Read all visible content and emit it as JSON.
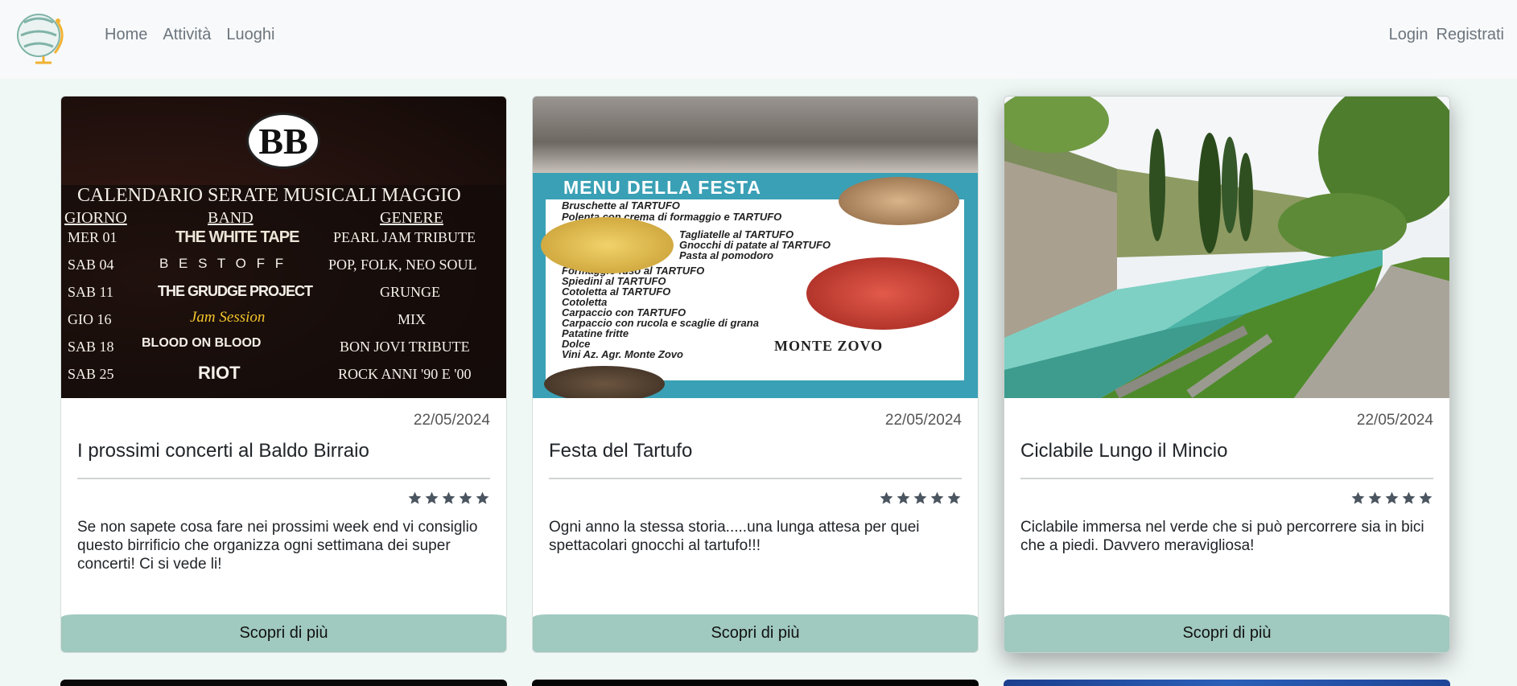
{
  "nav": {
    "left": [
      "Home",
      "Attività",
      "Luoghi"
    ],
    "right": [
      "Login",
      "Registrati"
    ]
  },
  "cards": [
    {
      "date": "22/05/2024",
      "title": "I prossimi concerti al Baldo Birraio",
      "rating": 5,
      "text": "Se non sapete cosa fare nei prossimi week end vi consiglio questo birrificio che organizza ogni settimana dei super concerti! Ci si vede li!",
      "button": "Scopri di più",
      "image": {
        "logo": "BB",
        "heading": "CALENDARIO SERATE MUSICALI MAGGIO",
        "columns": [
          "GIORNO",
          "BAND",
          "GENERE"
        ],
        "rows": [
          [
            "MER 01",
            "THE WHITE TAPE",
            "PEARL JAM TRIBUTE"
          ],
          [
            "SAB 04",
            "B E S T O F F",
            "POP, FOLK, NEO SOUL"
          ],
          [
            "SAB 11",
            "THE GRUDGE PROJECT",
            "GRUNGE"
          ],
          [
            "GIO 16",
            "Jam Session",
            "MIX"
          ],
          [
            "SAB 18",
            "BLOOD ON BLOOD",
            "BON JOVI TRIBUTE"
          ],
          [
            "SAB 25",
            "RIOT",
            "ROCK ANNI '90 E '00"
          ]
        ]
      }
    },
    {
      "date": "22/05/2024",
      "title": "Festa del Tartufo",
      "rating": 5,
      "text": "Ogni anno la stessa storia.....una lunga attesa per quei spettacolari gnocchi al tartufo!!!",
      "button": "Scopri di più",
      "image": {
        "heading": "MENU DELLA FESTA",
        "items": [
          "Bruschette al TARTUFO",
          "Polenta con crema di formaggio e TARTUFO",
          "Tagliatelle al TARTUFO",
          "Gnocchi di patate al TARTUFO",
          "Pasta al pomodoro",
          "Formaggio fuso al TARTUFO",
          "Spiedini al TARTUFO",
          "Cotoletta al TARTUFO",
          "Cotoletta",
          "Carpaccio con TARTUFO",
          "Carpaccio con rucola e scaglie di grana",
          "Patatine fritte",
          "Dolce",
          "Vini Az. Agr. Monte Zovo"
        ],
        "brand": "MONTE ZOVO"
      }
    },
    {
      "date": "22/05/2024",
      "title": "Ciclabile Lungo il Mincio",
      "rating": 5,
      "text": "Ciclabile immersa nel verde che si può percorrere sia in bici che a piedi. Davvero meravigliosa!",
      "button": "Scopri di più"
    }
  ],
  "colors": {
    "page_bg": "#f0f8f6",
    "navbar_bg": "#f8f9fa",
    "button_bg": "#a0c9bf",
    "star": "#4a5560"
  }
}
